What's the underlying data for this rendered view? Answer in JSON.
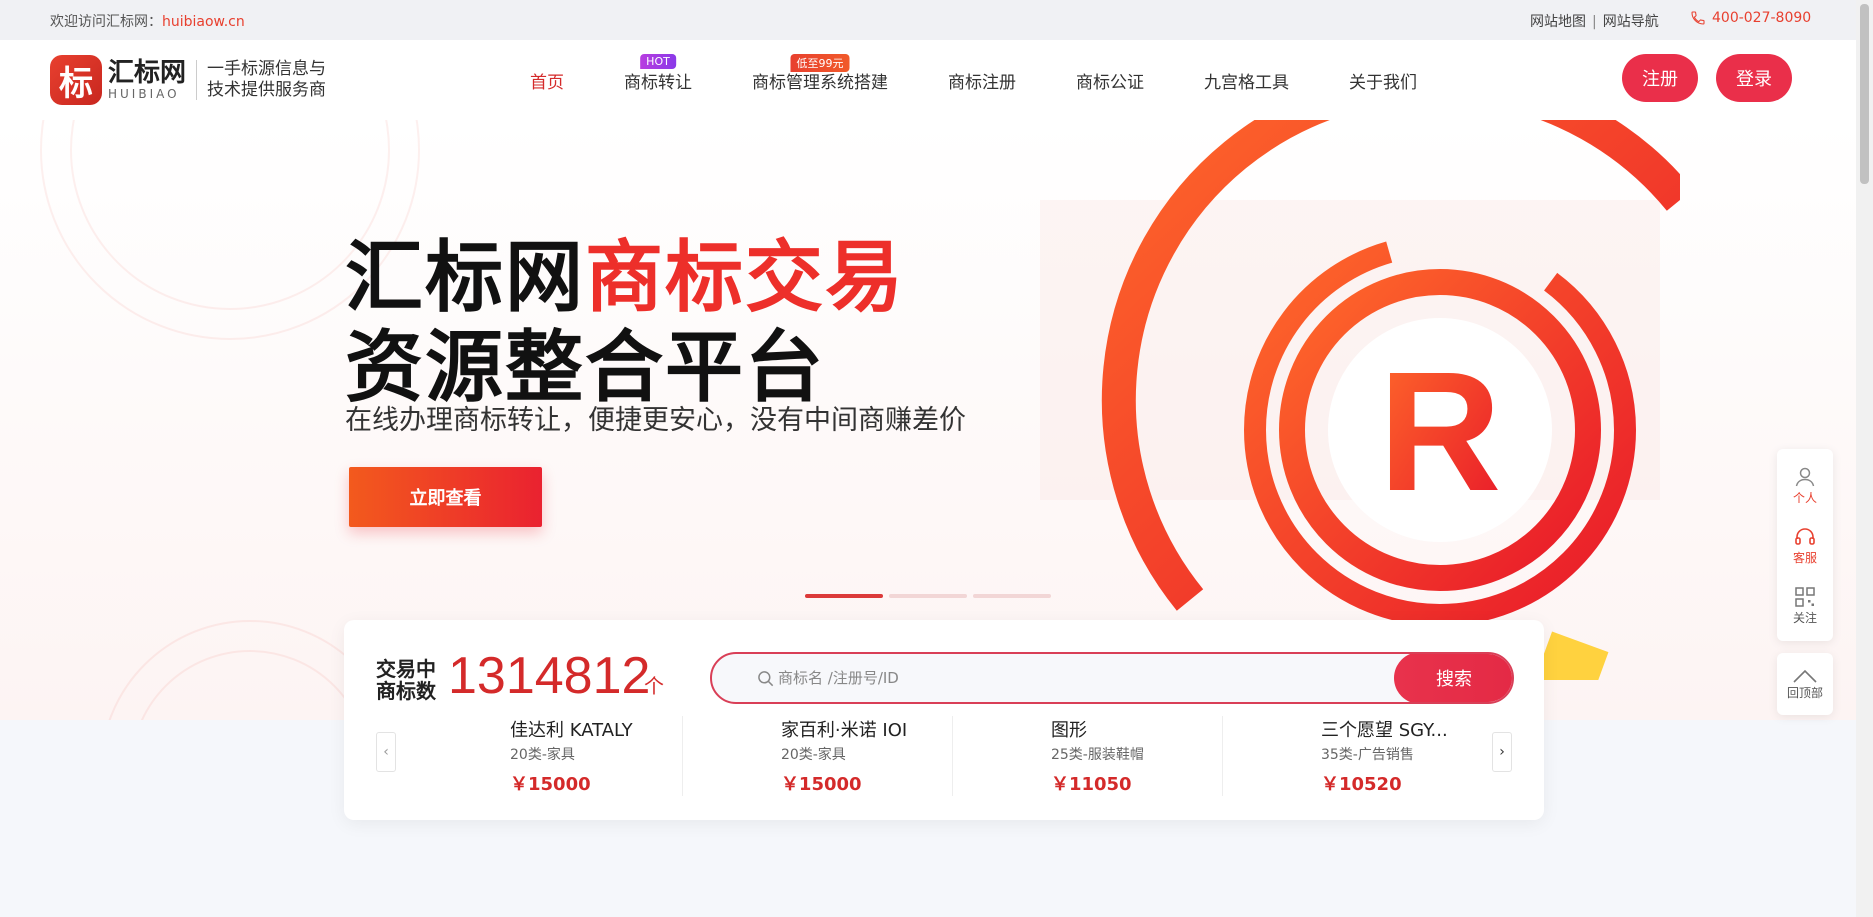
{
  "topbar": {
    "welcome": "欢迎访问汇标网：",
    "domain": "huibiaow.cn",
    "sitemap": "网站地图",
    "separator": "|",
    "nav_link": "网站导航",
    "phone": "400-027-8090"
  },
  "logo": {
    "mark": "标",
    "name_cn": "汇标网",
    "name_en": "HUIBIAO",
    "slogan_line1": "一手标源信息与",
    "slogan_line2": "技术提供服务商"
  },
  "nav": {
    "items": [
      {
        "label": "首页",
        "badge": ""
      },
      {
        "label": "商标转让",
        "badge": "HOT"
      },
      {
        "label": "商标管理系统搭建",
        "badge": "低至99元"
      },
      {
        "label": "商标注册",
        "badge": ""
      },
      {
        "label": "商标公证",
        "badge": ""
      },
      {
        "label": "九宫格工具",
        "badge": ""
      },
      {
        "label": "关于我们",
        "badge": ""
      }
    ],
    "register": "注册",
    "login": "登录"
  },
  "hero": {
    "title_part1": "汇标网",
    "title_part2": "商标交易",
    "title_line2": "资源整合平台",
    "subtitle": "在线办理商标转让，便捷更安心，没有中间商赚差价",
    "cta": "立即查看",
    "slide_active": 1,
    "slide_count": 3,
    "r_mark": "R"
  },
  "stats": {
    "label_line1": "交易中",
    "label_line2": "商标数",
    "count": "1314812",
    "unit": "个"
  },
  "search": {
    "placeholder": "商标名 /注册号/ID",
    "button": "搜索"
  },
  "trademarks": [
    {
      "name": "佳达利 KATALY",
      "class": "20类-家具",
      "price": "￥15000"
    },
    {
      "name": "家百利·米诺 IOI",
      "class": "20类-家具",
      "price": "￥15000"
    },
    {
      "name": "图形",
      "class": "25类-服装鞋帽",
      "price": "￥11050"
    },
    {
      "name": "三个愿望 SGY...",
      "class": "35类-广告销售",
      "price": "￥10520"
    }
  ],
  "sidebar": {
    "personal": "个人",
    "service": "客服",
    "follow": "关注",
    "back_top": "回顶部"
  },
  "colors": {
    "brand_red": "#e8402f",
    "button_red": "#ea2f4a",
    "price_red": "#d42a2a"
  }
}
